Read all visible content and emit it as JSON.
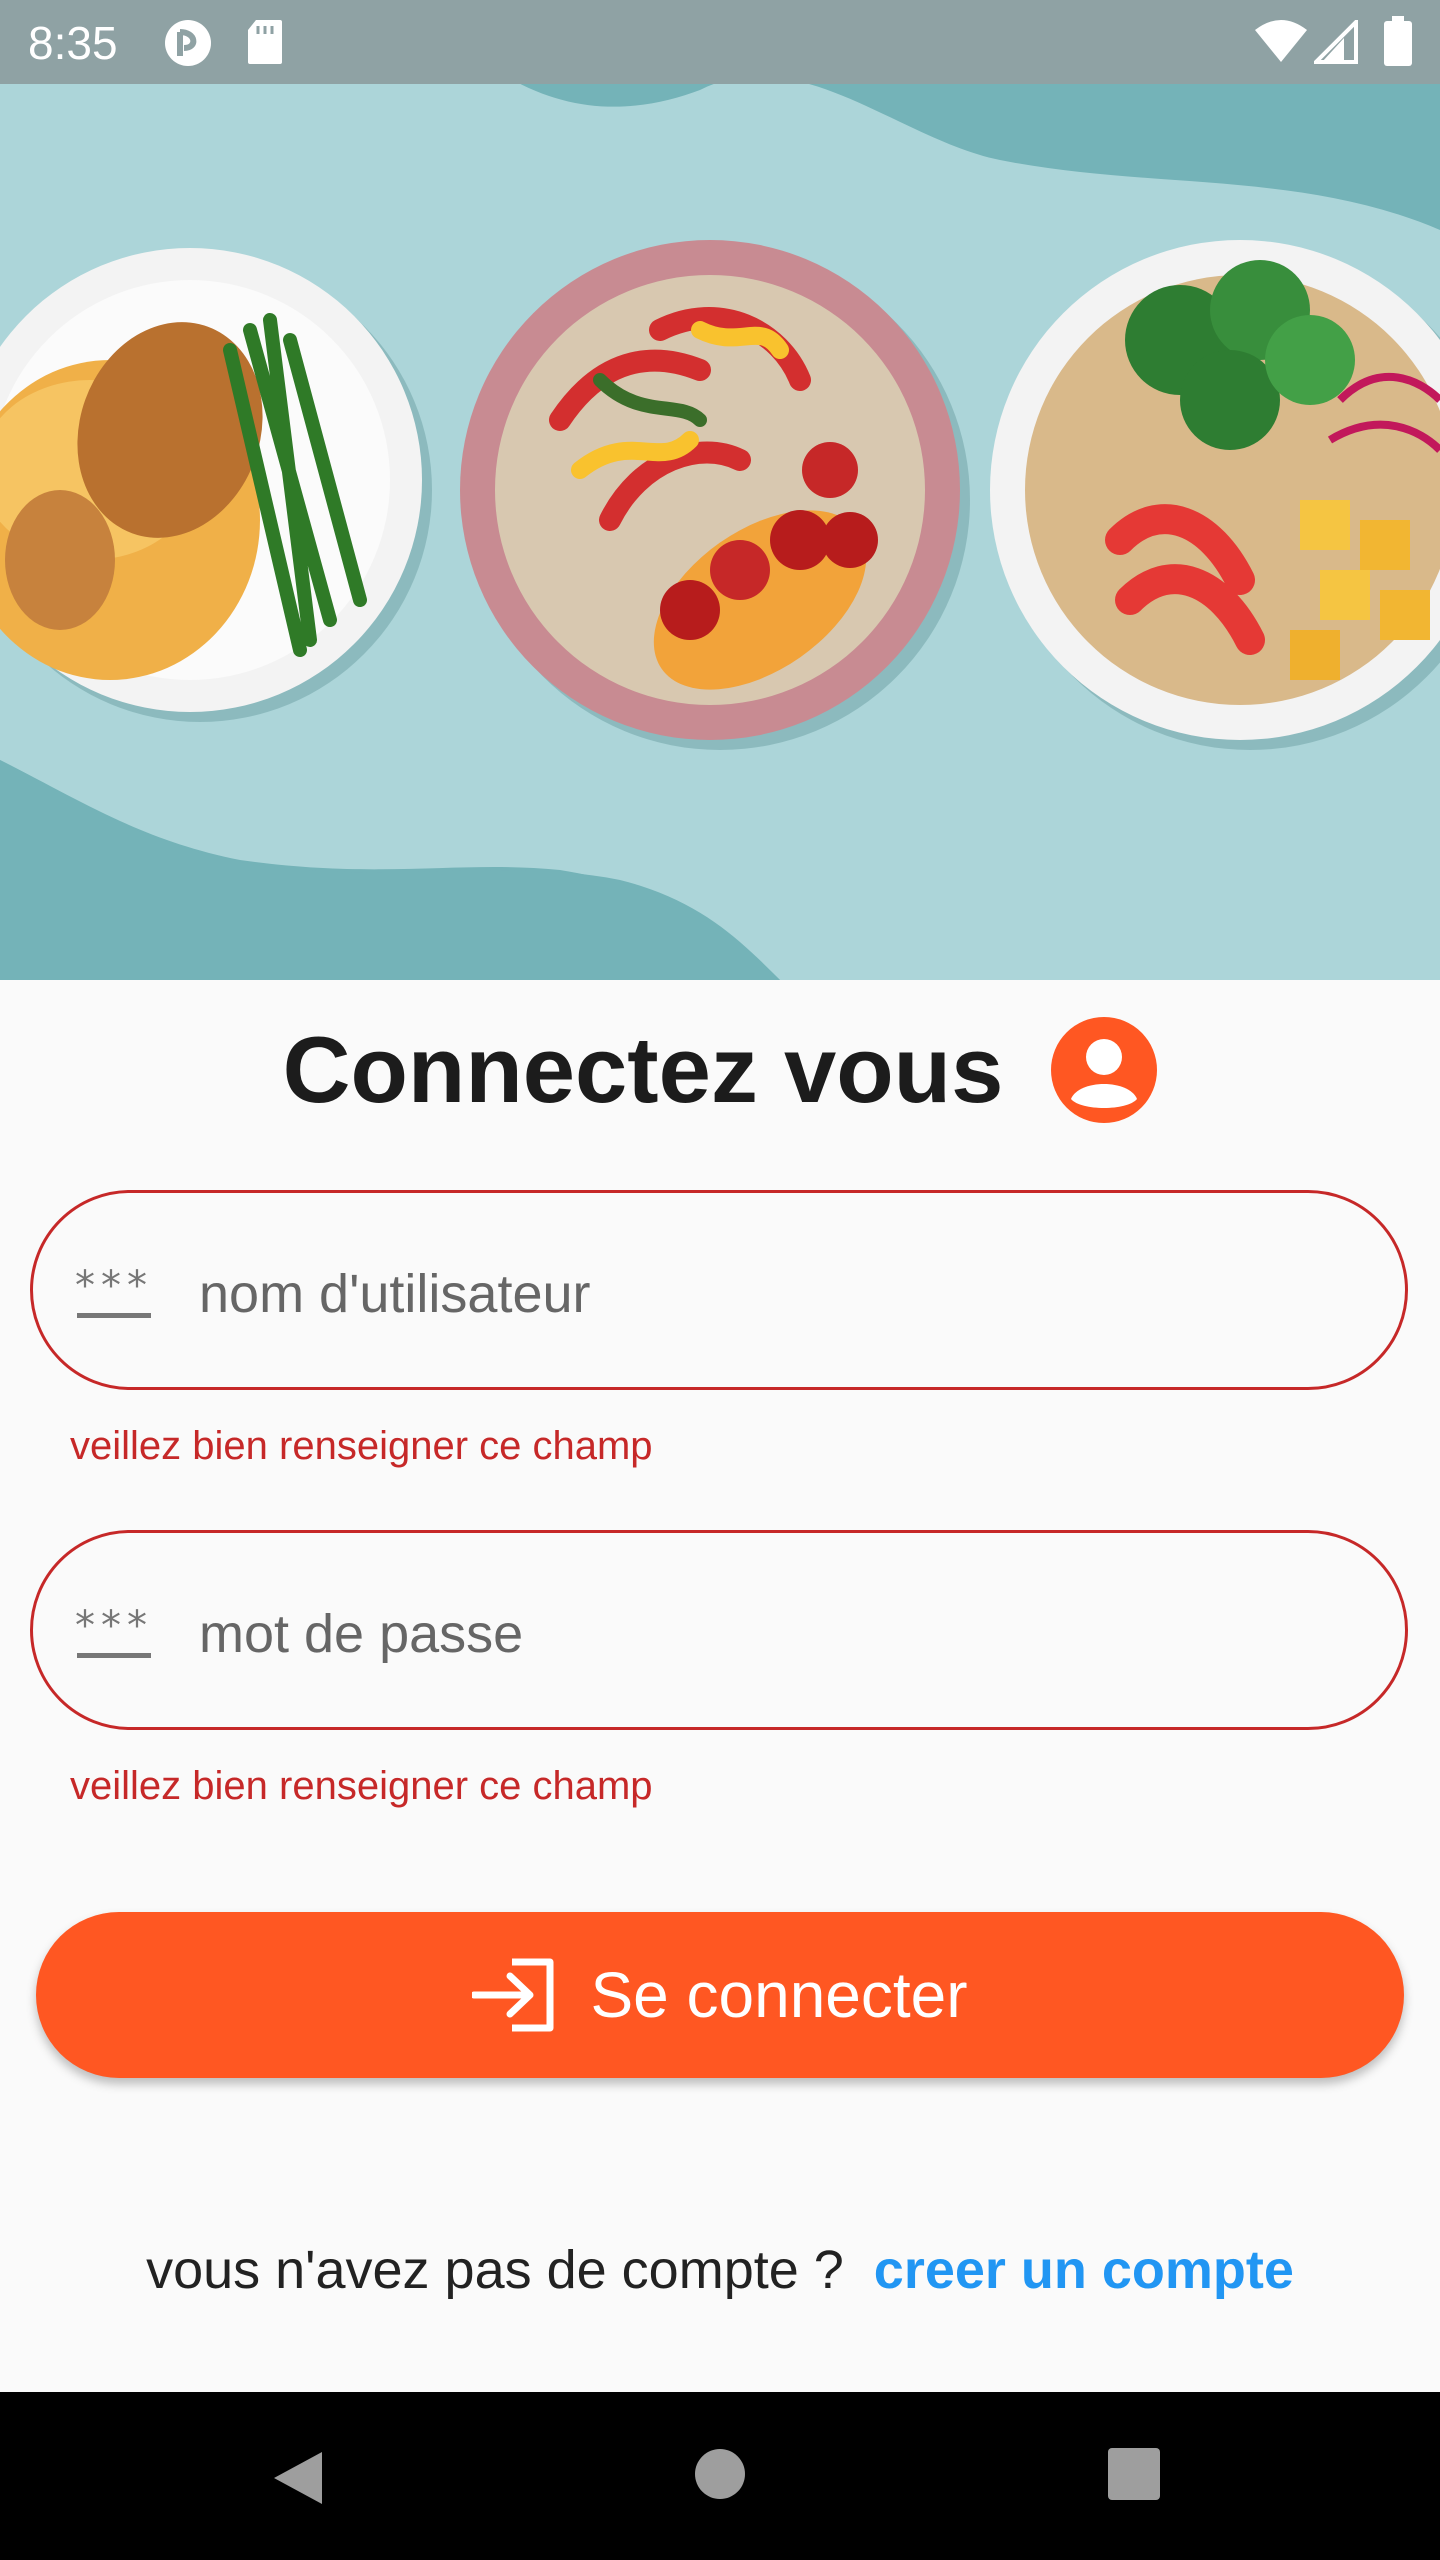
{
  "status_bar": {
    "time": "8:35",
    "left_icons": [
      "notification-app-icon",
      "sd-card-icon"
    ],
    "right_icons": [
      "wifi-icon",
      "cell-signal-icon",
      "battery-icon"
    ]
  },
  "hero": {
    "icon": "food-bowls-banner",
    "background_color": "#74b3b8"
  },
  "header": {
    "title": "Connectez vous",
    "icon": "account-circle-icon",
    "icon_color": "#ff5722"
  },
  "form": {
    "username": {
      "placeholder": "nom d'utilisateur",
      "value": "",
      "icon": "password-icon",
      "error": "veillez bien renseigner ce champ"
    },
    "password": {
      "placeholder": "mot de passe",
      "value": "",
      "icon": "password-icon",
      "error": "veillez bien renseigner ce champ"
    },
    "error_color": "#c62828"
  },
  "login_button": {
    "label": "Se connecter",
    "icon": "login-icon",
    "color": "#ff5722"
  },
  "footer": {
    "prompt": "vous n'avez pas de compte ?",
    "link": "creer un compte",
    "link_color": "#2196f3"
  },
  "nav_bar": {
    "icons": [
      "back-icon",
      "home-icon",
      "recents-icon"
    ]
  }
}
